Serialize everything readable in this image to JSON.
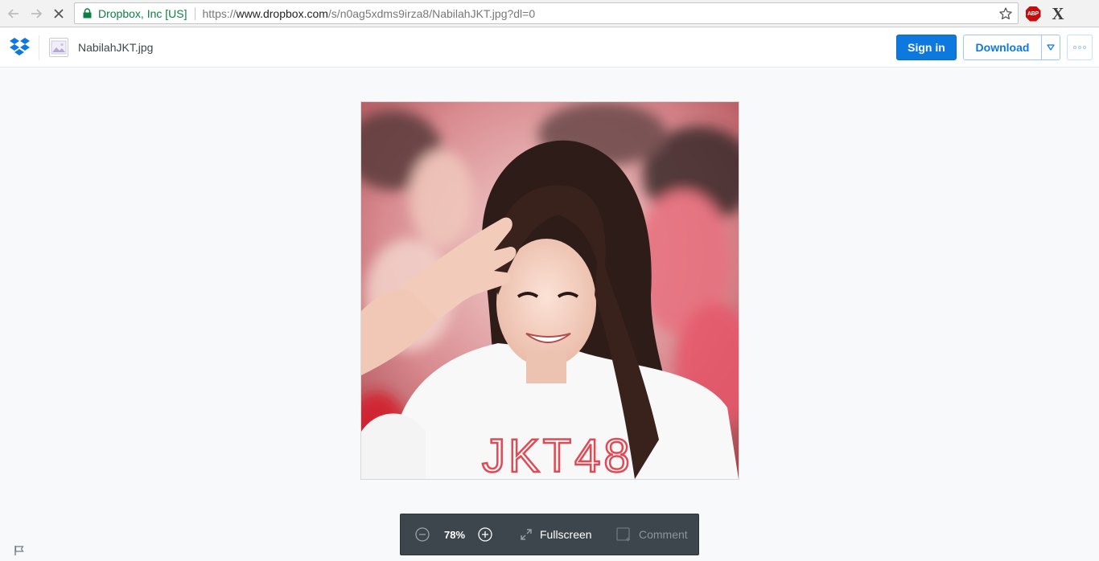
{
  "browser": {
    "site_identity": "Dropbox, Inc [US]",
    "url_scheme": "https://",
    "url_host": "www.dropbox.com",
    "url_path": "/s/n0ag5xdms9irza8/NabilahJKT.jpg?dl=0",
    "abp_label": "ABP",
    "ext_x_label": "X"
  },
  "header": {
    "file_name": "NabilahJKT.jpg",
    "sign_in_label": "Sign in",
    "download_label": "Download"
  },
  "preview": {
    "shirt_text": "JKT48"
  },
  "toolbar": {
    "zoom_value": "78%",
    "fullscreen_label": "Fullscreen",
    "comment_label": "Comment"
  },
  "colors": {
    "brand_blue": "#0d79de",
    "toolbar_bg": "#3d464d",
    "page_bg": "#f7f9fa",
    "secure_green": "#0b8043"
  },
  "icons": [
    "back-arrow-icon",
    "forward-arrow-icon",
    "stop-loading-icon",
    "lock-icon",
    "star-icon",
    "adblock-icon",
    "dropbox-logo-icon",
    "image-file-icon",
    "caret-down-icon",
    "more-dots-icon",
    "zoom-out-icon",
    "zoom-in-icon",
    "fullscreen-icon",
    "comment-icon",
    "flag-icon"
  ]
}
